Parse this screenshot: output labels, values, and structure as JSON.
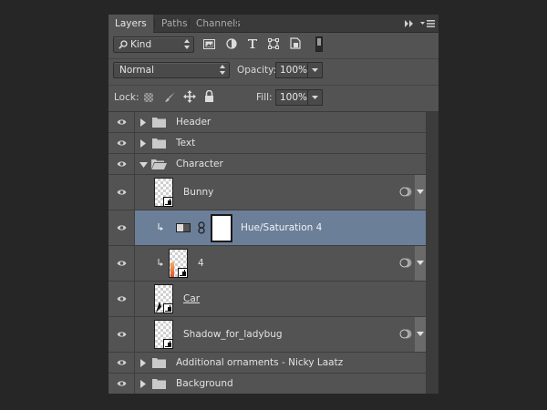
{
  "tabs": [
    {
      "label": "Layers",
      "active": true
    },
    {
      "label": "Paths",
      "active": false
    },
    {
      "label": "Channels",
      "active": false
    }
  ],
  "filter": {
    "kind_label": "Kind"
  },
  "blend": {
    "mode": "Normal",
    "opacity_label": "Opacity:",
    "opacity_value": "100%",
    "lock_label": "Lock:",
    "fill_label": "Fill:",
    "fill_value": "100%"
  },
  "layers": [
    {
      "name": "Header",
      "type": "group",
      "expanded": false
    },
    {
      "name": "Text",
      "type": "group",
      "expanded": false
    },
    {
      "name": "Character",
      "type": "group",
      "expanded": true
    },
    {
      "name": "Bunny",
      "type": "smart-object",
      "has_fx": true
    },
    {
      "name": "Hue/Saturation 4",
      "type": "adjustment",
      "selected": true,
      "clipped": true
    },
    {
      "name": "4",
      "type": "smart-object",
      "has_fx": true,
      "clipped": true
    },
    {
      "name": "Car",
      "type": "smart-object",
      "underlined": true
    },
    {
      "name": "Shadow_for_ladybug",
      "type": "smart-object",
      "has_fx": true
    },
    {
      "name": "Additional ornaments - Nicky Laatz",
      "type": "group",
      "expanded": false
    },
    {
      "name": "Background",
      "type": "group",
      "expanded": false
    }
  ],
  "colors": {
    "selected_row": "#6c7f99",
    "panel": "#535353",
    "tabbar": "#3a3a3a"
  }
}
